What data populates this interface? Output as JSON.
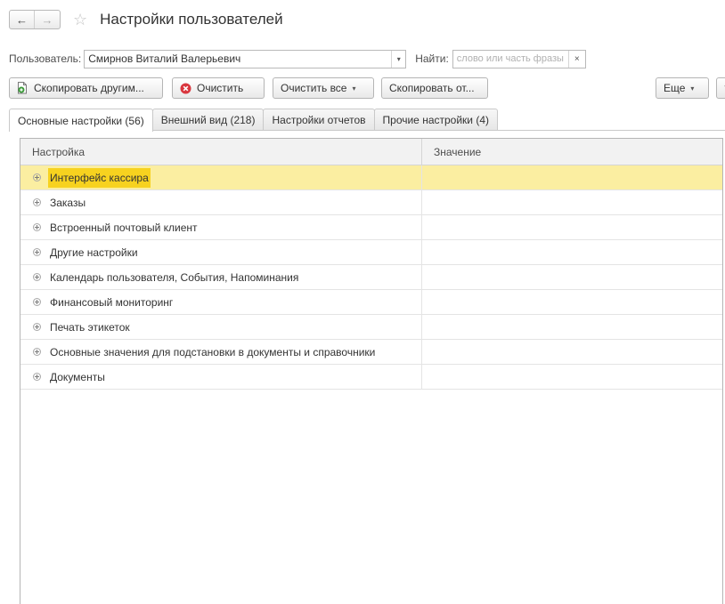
{
  "header": {
    "back_label": "←",
    "forward_label": "→",
    "favorite_icon": "☆",
    "title": "Настройки пользователей"
  },
  "filter": {
    "user_label": "Пользователь:",
    "user_value": "Смирнов Виталий Валерьевич",
    "dropdown_glyph": "▾",
    "find_label": "Найти:",
    "find_placeholder": "слово или часть фразы",
    "find_value": "",
    "clear_glyph": "×"
  },
  "toolbar": {
    "copy_to_others": "Скопировать другим...",
    "clear": "Очистить",
    "clear_all": "Очистить все",
    "copy_from": "Скопировать от...",
    "more": "Еще",
    "help": "?",
    "caret": "▾"
  },
  "tabs": [
    {
      "label": "Основные настройки (56)",
      "active": true
    },
    {
      "label": "Внешний вид (218)",
      "active": false
    },
    {
      "label": "Настройки отчетов",
      "active": false
    },
    {
      "label": "Прочие настройки (4)",
      "active": false
    }
  ],
  "grid": {
    "columns": [
      "Настройка",
      "Значение"
    ],
    "rows": [
      {
        "label": "Интерфейс кассира",
        "value": "",
        "selected": true
      },
      {
        "label": "Заказы",
        "value": ""
      },
      {
        "label": "Встроенный почтовый клиент",
        "value": ""
      },
      {
        "label": "Другие настройки",
        "value": ""
      },
      {
        "label": "Календарь пользователя, События, Напоминания",
        "value": ""
      },
      {
        "label": "Финансовый мониторинг",
        "value": ""
      },
      {
        "label": "Печать этикеток",
        "value": ""
      },
      {
        "label": "Основные значения для подстановки в документы и справочники",
        "value": ""
      },
      {
        "label": "Документы",
        "value": ""
      }
    ]
  },
  "colors": {
    "selected_row": "#fbeea1",
    "selected_text_highlight": "#f7d21f",
    "clear_icon": "#d9373f",
    "copy_icon": "#3c9a3a"
  },
  "icons": {
    "copy_to_others": "document-copy-icon",
    "clear": "clear-red-circle-icon",
    "row_expander": "plus-circle-expander-icon"
  }
}
